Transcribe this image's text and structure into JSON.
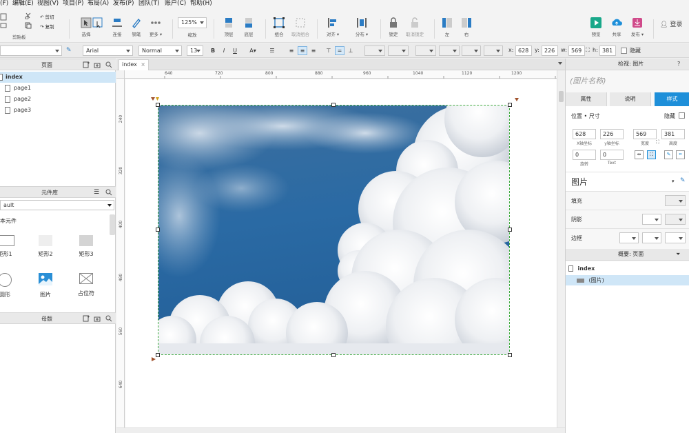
{
  "menu": [
    "(F)",
    "编辑(E)",
    "视图(V)",
    "项目(P)",
    "布局(A)",
    "发布(P)",
    "团队(T)",
    "账户(C)",
    "帮助(H)"
  ],
  "toolbar": {
    "clipboard_label": "剪贴板",
    "cut": "剪切",
    "copy": "复制",
    "select_label": "选择",
    "connect_label": "连接",
    "pen_label": "钢笔",
    "more_label": "更多",
    "zoom_value": "125%",
    "zoom_label": "缩放",
    "top_label": "顶层",
    "bottom_label": "底层",
    "group_label": "组合",
    "ungroup_label": "取消组合",
    "align_label": "对齐",
    "distribute_label": "分布",
    "lock_label": "锁定",
    "unlock_label": "取消锁定",
    "left_label": "左",
    "right_label": "右",
    "preview_label": "预览",
    "share_label": "共享",
    "publish_label": "发布",
    "login_label": "登录"
  },
  "format": {
    "font_family": "Arial",
    "font_style": "Normal",
    "font_size": "13",
    "x_label": "x:",
    "x_value": "628",
    "y_label": "y:",
    "y_value": "226",
    "w_label": "w:",
    "w_value": "569",
    "h_label": "h:",
    "h_value": "381",
    "hidden_label": "隐藏"
  },
  "pages_panel": {
    "title": "页面",
    "items": [
      "index",
      "page1",
      "page2",
      "page3"
    ]
  },
  "library_panel": {
    "title": "元件库",
    "library_select": "ault",
    "section": "本元件",
    "components": [
      "矩形1",
      "矩形2",
      "矩形3",
      "圆形",
      "图片",
      "占位符"
    ]
  },
  "masters_panel": {
    "title": "母版"
  },
  "canvas": {
    "tab": "index",
    "h_ticks": [
      "640",
      "720",
      "800",
      "880",
      "960",
      "1040",
      "1120",
      "1200"
    ],
    "v_ticks": [
      "240",
      "320",
      "400",
      "480",
      "560",
      "640"
    ]
  },
  "inspector": {
    "header": "检视: 图片",
    "widget_name_placeholder": "(图片名称)",
    "tabs": [
      "属性",
      "说明",
      "样式"
    ],
    "position_size": "位置 • 尺寸",
    "hidden_label": "隐藏",
    "x": "628",
    "y": "226",
    "w": "569",
    "h": "381",
    "x_label": "X轴坐标",
    "y_label": "y轴坐标",
    "w_label": "宽度",
    "h_label": "高度",
    "rotate": "0",
    "rotate_label": "旋转",
    "text_rotate": "0",
    "text_label": "Text",
    "style_name": "图片",
    "fill_label": "填充",
    "shadow_label": "阴影",
    "border_label": "边框"
  },
  "outline": {
    "title": "概要: 页面",
    "page": "index",
    "item": "(图片)"
  },
  "colors": {
    "accent": "#1e8fd9",
    "selection_green": "#3caa3c",
    "sky_blue": "#2d6ea8"
  }
}
